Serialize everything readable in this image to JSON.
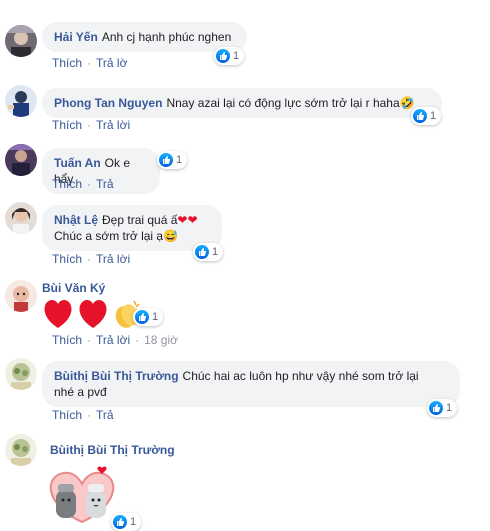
{
  "colors": {
    "name": "#385898",
    "meta": "#90949c",
    "bubble": "#f2f3f5",
    "like": "#1877f2",
    "heart": "#e6122a"
  },
  "ui": {
    "like_label": "Thích",
    "reply_label": "Trả lời",
    "reply_partial": "Trả",
    "reply_partial_2": "Trả lờ",
    "react_count": "1"
  },
  "comments": [
    {
      "name": "Hải Yến",
      "text": "Anh cj hạnh phúc nghen",
      "reactions": "1"
    },
    {
      "name": "Phong Tan Nguyen",
      "text": "Nnay azai lại có động lực sớm trở lại r haha",
      "emoji": "rofl-icon",
      "reactions": "1"
    },
    {
      "name": "Tuấn An",
      "text": "Ok e hẩy",
      "reactions": "1"
    },
    {
      "name": "Nhật Lệ",
      "line1": "Đẹp trai quá ấ",
      "line2": "Chúc a sớm trở lại ạ",
      "emoji": "grin-sweat-icon",
      "reactions": "1"
    },
    {
      "name": "Bùi Văn Ký",
      "emojis": [
        "heart-icon",
        "heart-icon",
        "clapping-hands-icon"
      ],
      "reactions": "1",
      "time": "18 giờ"
    },
    {
      "name": "Bùithị Bùi Thị Trường",
      "line1": "Chúc hai ac luôn hp như vậy nhé som trở lại",
      "line2": "nhé a pvđ",
      "reactions": "1"
    },
    {
      "name": "Bùithị Bùi Thị Trường",
      "sticker": "salt-pepper-couple-sticker",
      "reactions": "1"
    }
  ]
}
